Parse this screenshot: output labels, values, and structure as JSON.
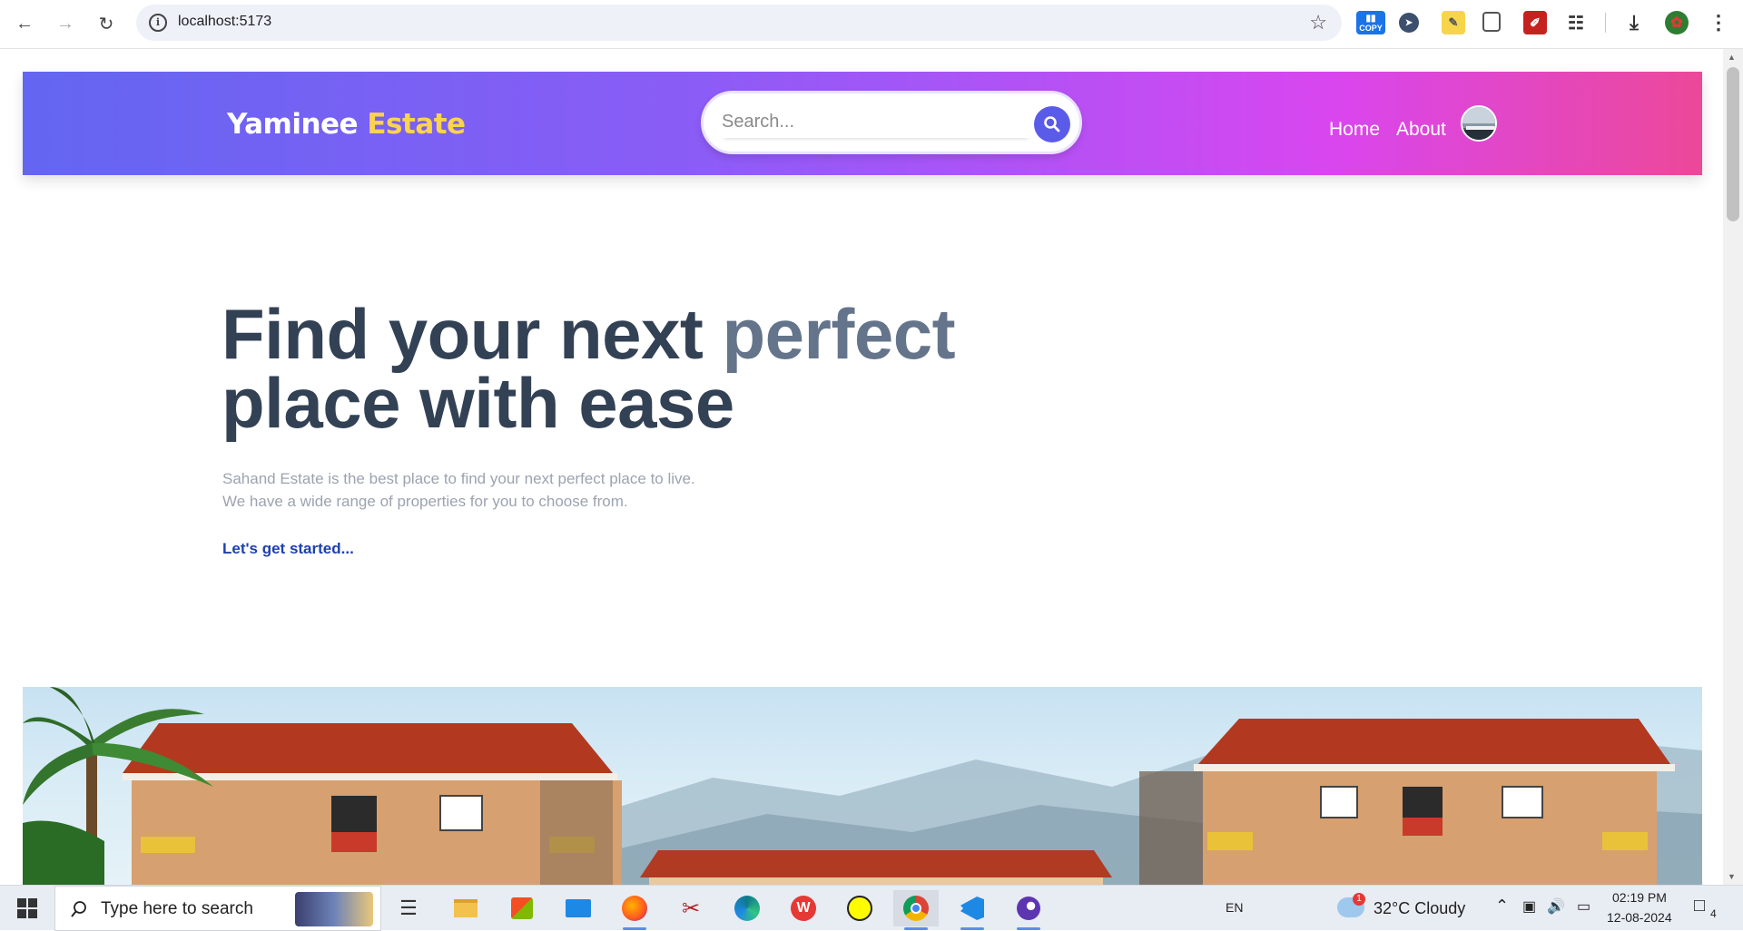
{
  "browser": {
    "url": "localhost:5173",
    "extensions": [
      "copy-extension-icon",
      "cursor-extension-icon",
      "note-extension-icon",
      "tab-extension-icon",
      "pdf-extension-icon",
      "puzzle-extension-icon"
    ],
    "copy_label": "COPY"
  },
  "header": {
    "logo_part1": "Yaminee",
    "logo_part2": "Estate",
    "search_placeholder": "Search...",
    "nav": [
      {
        "label": "Home"
      },
      {
        "label": "About"
      }
    ],
    "gradient_start": "#6366f1",
    "gradient_end": "#ec4899",
    "logo_accent": "#fcd34d"
  },
  "hero": {
    "title_part1": "Find your next",
    "title_accent": "perfect",
    "title_line2": "place with ease",
    "description_line1": "Sahand Estate is the best place to find your next perfect place to live.",
    "description_line2": "We have a wide range of properties for you to choose from.",
    "cta": "Let's get started..."
  },
  "taskbar": {
    "search_placeholder": "Type here to search",
    "language": "EN",
    "weather": "32°C  Cloudy",
    "weather_badge": "1",
    "time": "02:19 PM",
    "date": "12-08-2024",
    "notifications": "4"
  }
}
